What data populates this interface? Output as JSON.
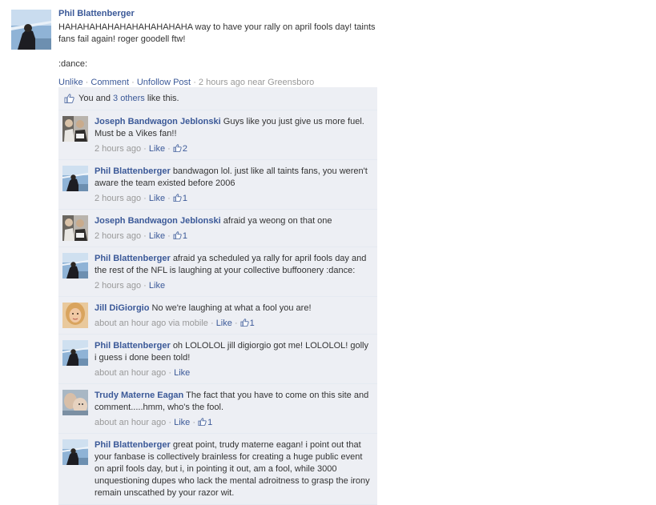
{
  "post": {
    "author": "Phil Blattenberger",
    "text": "HAHAHAHAHAHAHAHAHAHAHA way to have your rally on april fools day! taints fans fail again! roger goodell ftw!",
    "text2": ":dance:",
    "actions": {
      "unlike": "Unlike",
      "comment": "Comment",
      "unfollow": "Unfollow Post",
      "sep": "·",
      "time": "2 hours ago near Greensboro"
    }
  },
  "likes": {
    "you_and": "You and",
    "others": "3 others",
    "like_this": "like this."
  },
  "comments": [
    {
      "author": "Joseph Bandwagon Jeblonski",
      "text": "Guys like you just give us more fuel. Must be a Vikes fan!!",
      "time": "2 hours ago",
      "like": "Like",
      "count": "2",
      "avatar": "joseph"
    },
    {
      "author": "Phil Blattenberger",
      "text": "bandwagon lol. just like all taints fans, you weren't aware the team existed before 2006",
      "time": "2 hours ago",
      "like": "Like",
      "count": "1",
      "avatar": "phil"
    },
    {
      "author": "Joseph Bandwagon Jeblonski",
      "text": "afraid ya weong on that one",
      "time": "2 hours ago",
      "like": "Like",
      "count": "1",
      "avatar": "joseph"
    },
    {
      "author": "Phil Blattenberger",
      "text": "afraid ya scheduled ya rally for april fools day and the rest of the NFL is laughing at your collective buffoonery :dance:",
      "time": "2 hours ago",
      "like": "Like",
      "count": "",
      "avatar": "phil"
    },
    {
      "author": "Jill DiGiorgio",
      "text": "No we're laughing at what a fool you are!",
      "time": "about an hour ago via mobile",
      "like": "Like",
      "count": "1",
      "avatar": "jill"
    },
    {
      "author": "Phil Blattenberger",
      "text": "oh LOLOLOL jill digiorgio got me! LOLOLOL! golly i guess i done been told!",
      "time": "about an hour ago",
      "like": "Like",
      "count": "",
      "avatar": "phil"
    },
    {
      "author": "Trudy Materne Eagan",
      "text": "The fact that you have to come on this site and comment.....hmm, who's the fool.",
      "time": "about an hour ago",
      "like": "Like",
      "count": "1",
      "avatar": "trudy"
    },
    {
      "author": "Phil Blattenberger",
      "text": "great point, trudy materne eagan! i point out that your fanbase is collectively brainless for creating a huge public event on april fools day, but i, in pointing it out, am a fool, while 3000 unquestioning dupes who lack the mental adroitness to grasp the irony remain unscathed by your razor wit.",
      "time": "",
      "like": "",
      "count": "",
      "avatar": "phil"
    }
  ],
  "colors": {
    "link": "#3b5998",
    "feedback_bg": "#edeff4",
    "meta": "#999999"
  }
}
